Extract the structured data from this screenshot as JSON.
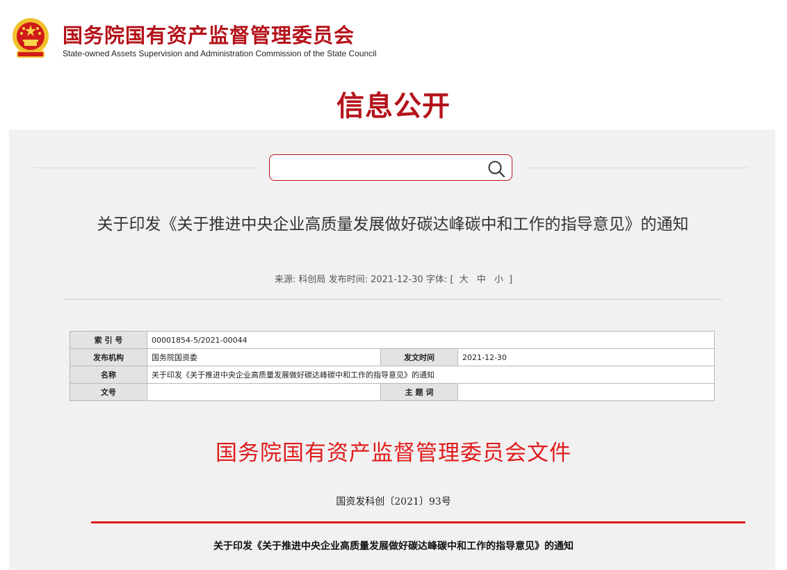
{
  "header": {
    "org_name_cn": "国务院国有资产监督管理委员会",
    "org_name_en": "State-owned Assets Supervision and Administration Commission of the State Council",
    "emblem_icon": "national-emblem-icon"
  },
  "section_title": "信息公开",
  "search": {
    "value": "",
    "placeholder": "",
    "icon": "search-icon"
  },
  "article": {
    "title": "关于印发《关于推进中央企业高质量发展做好碳达峰碳中和工作的指导意见》的通知",
    "meta": {
      "source_label": "来源:",
      "source_value": "科创局",
      "time_label": "发布时间:",
      "time_value": "2021-12-30",
      "font_label": "字体:",
      "bracket_open": "[",
      "size_large": "大",
      "size_medium": "中",
      "size_small": "小",
      "bracket_close": "]"
    }
  },
  "info_table": {
    "index_label": "索 引 号",
    "index_value": "00001854-5/2021-00044",
    "publisher_label": "发布机构",
    "publisher_value": "国务院国资委",
    "date_label": "发文时间",
    "date_value": "2021-12-30",
    "name_label": "名称",
    "name_value": "关于印发《关于推进中央企业高质量发展做好碳达峰碳中和工作的指导意见》的通知",
    "docno_label": "文号",
    "docno_value": "",
    "subject_label": "主 题 词",
    "subject_value": ""
  },
  "document": {
    "heading": "国务院国有资产监督管理委员会文件",
    "number": "国资发科创〔2021〕93号",
    "title": "关于印发《关于推进中央企业高质量发展做好碳达峰碳中和工作的指导意见》的通知"
  },
  "colors": {
    "brand_red": "#b5131b",
    "doc_red": "#e01b1b",
    "panel_grey": "#f1f1f1"
  }
}
